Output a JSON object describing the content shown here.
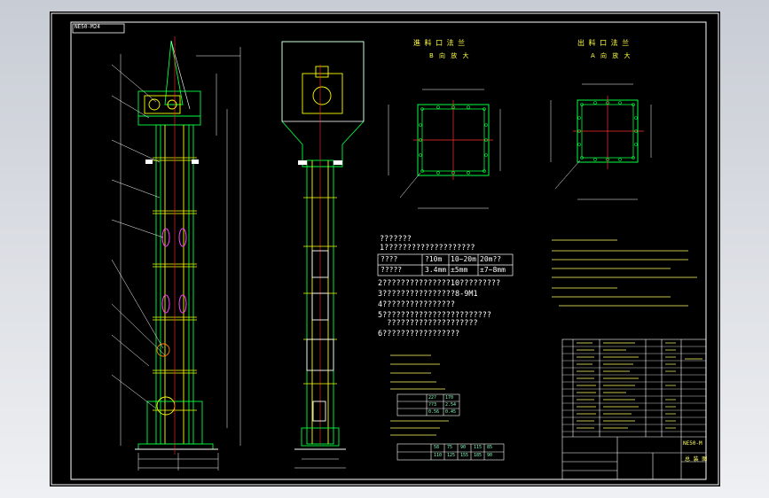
{
  "drawing": {
    "code_stamp": "NE50-M24",
    "view_b_title": "進 料 口 法 兰",
    "view_b_sub": "B 向 放 大",
    "view_a_title": "出 料 口 法 兰",
    "view_a_sub": "A 向 放 大"
  },
  "notes": {
    "heading": "???????",
    "line1": "1????????????????????",
    "table": [
      [
        "????",
        "?10m",
        "10~20m",
        "20m??"
      ],
      [
        "?????",
        "3.4mm",
        "±5mm",
        "±7~8mm"
      ]
    ],
    "line2": "2???????????????10?????????",
    "line3": "3????????????????8-9M1",
    "line4": "4????????????????",
    "line5": "5????????????????????????",
    "line5b": "  ????????????????????",
    "line6": "6?????????????????"
  },
  "params": {
    "row1": [
      "22?",
      "170"
    ],
    "row2": [
      "??3",
      "2.54"
    ],
    "row3": [
      "0.56",
      "0.45"
    ],
    "speed_row": [
      "58",
      "75",
      "90",
      "115",
      "85",
      "70"
    ],
    "speed_row2": [
      "110",
      "125",
      "155",
      "185",
      "90",
      "75"
    ]
  },
  "title_block": {
    "drawing_no": "NE50-M",
    "part_name": "总 装 图"
  }
}
